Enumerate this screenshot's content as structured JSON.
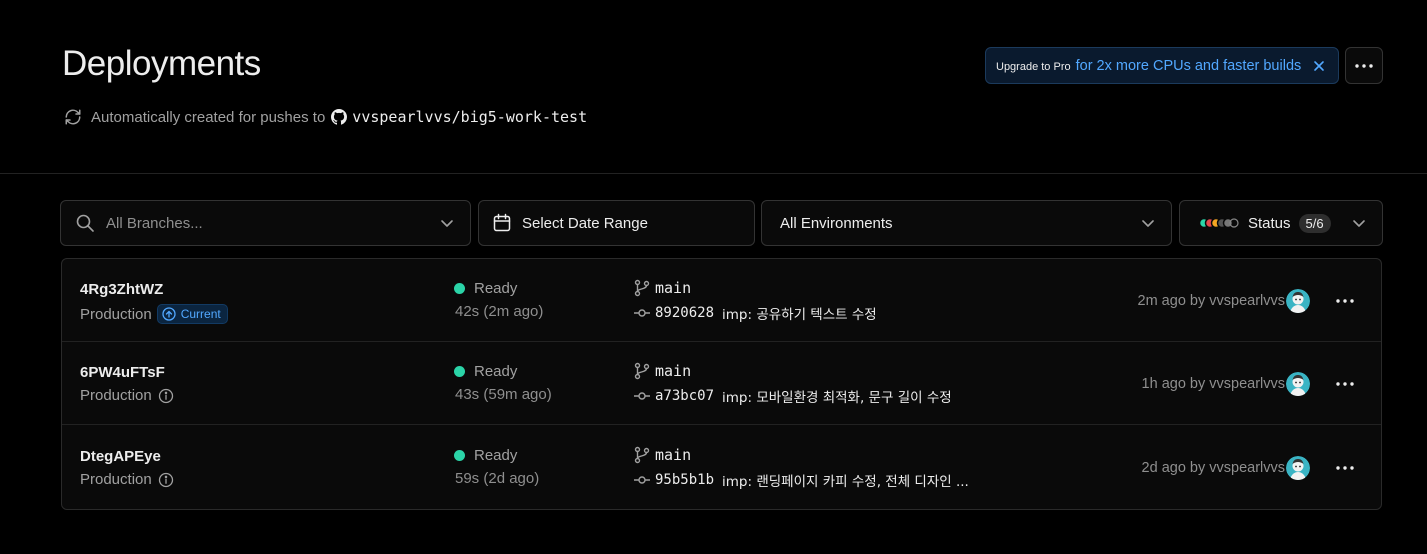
{
  "header": {
    "title": "Deployments",
    "subtitle_prefix": "Automatically created for pushes to",
    "repo": "vvspearlvvs/big5-work-test",
    "upgrade_label": "Upgrade to Pro",
    "upgrade_promo": "for 2x more CPUs and faster builds",
    "accent_color": "#52a8ff"
  },
  "filters": {
    "branch_placeholder": "All Branches...",
    "date_label": "Select Date Range",
    "environment_label": "All Environments",
    "status_label": "Status",
    "status_count": "5/6"
  },
  "deployments": [
    {
      "id": "4Rg3ZhtWZ",
      "environment": "Production",
      "current_badge": "Current",
      "status": "Ready",
      "duration": "42s (2m ago)",
      "branch": "main",
      "sha": "8920628",
      "message": "imp: 공유하기 텍스트 수정",
      "meta": "2m ago by vvspearlvvs"
    },
    {
      "id": "6PW4uFTsF",
      "environment": "Production",
      "status": "Ready",
      "duration": "43s (59m ago)",
      "branch": "main",
      "sha": "a73bc07",
      "message": "imp: 모바일환경 최적화, 문구 길이 수정",
      "meta": "1h ago by vvspearlvvs"
    },
    {
      "id": "DtegAPEye",
      "environment": "Production",
      "status": "Ready",
      "duration": "59s (2d ago)",
      "branch": "main",
      "sha": "95b5b1b",
      "message": "imp: 랜딩페이지 카피 수정, 전체 디자인 ...",
      "meta": "2d ago by vvspearlvvs"
    }
  ],
  "colors": {
    "ready": "#2bd4a8",
    "background": "#000000"
  }
}
